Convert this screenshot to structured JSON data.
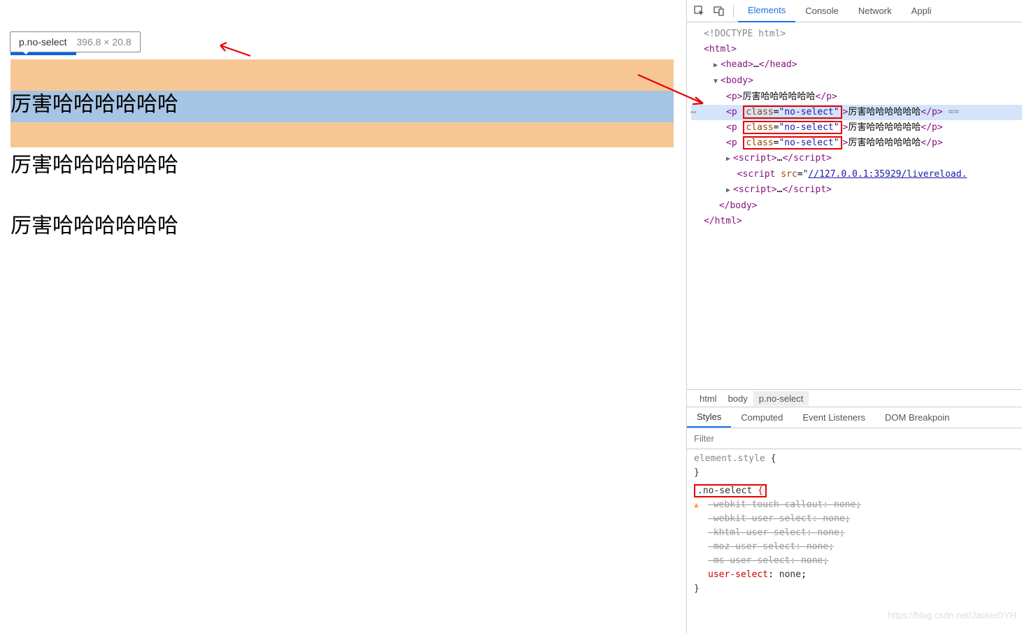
{
  "tooltip": {
    "selector": "p.no-select",
    "dims": "396.8 × 20.8"
  },
  "paragraphs": [
    "哈哈哈",
    "厉害哈哈哈哈哈哈",
    "厉害哈哈哈哈哈哈",
    "厉害哈哈哈哈哈哈"
  ],
  "devtools": {
    "tabs": [
      "Elements",
      "Console",
      "Network",
      "Appli"
    ],
    "active_tab": "Elements",
    "dom": {
      "doctype": "<!DOCTYPE html>",
      "html_open": "html",
      "head": {
        "open": "head",
        "close": "/head",
        "ellipsis": "…"
      },
      "body_open": "body",
      "p_lines": [
        {
          "text": "厉害哈哈哈哈哈哈",
          "has_class": false,
          "selected": false
        },
        {
          "text": "厉害哈哈哈哈哈哈",
          "has_class": true,
          "selected": true
        },
        {
          "text": "厉害哈哈哈哈哈哈",
          "has_class": true,
          "selected": false
        },
        {
          "text": "厉害哈哈哈哈哈哈",
          "has_class": true,
          "selected": false
        }
      ],
      "class_attr": "class",
      "class_val": "\"no-select\"",
      "script_ellipsis": "…",
      "script_src": "//127.0.0.1:35929/livereload.",
      "body_close": "/body",
      "html_close": "/html"
    },
    "breadcrumb": [
      "html",
      "body",
      "p.no-select"
    ],
    "styles_tabs": [
      "Styles",
      "Computed",
      "Event Listeners",
      "DOM Breakpoin"
    ],
    "styles_active": "Styles",
    "filter_placeholder": "Filter",
    "rules": {
      "elem_style": "element.style",
      "no_select": ".no-select",
      "props": [
        {
          "name": "-webkit-touch-callout",
          "value": "none",
          "striked": true,
          "warn": true
        },
        {
          "name": "-webkit-user-select",
          "value": "none",
          "striked": true,
          "warn": false
        },
        {
          "name": "-khtml-user-select",
          "value": "none",
          "striked": true,
          "warn": false
        },
        {
          "name": "-moz-user-select",
          "value": "none",
          "striked": true,
          "warn": false
        },
        {
          "name": "-ms-user-select",
          "value": "none",
          "striked": true,
          "warn": false
        },
        {
          "name": "user-select",
          "value": "none",
          "striked": false,
          "warn": false
        }
      ]
    }
  },
  "watermark": "https://blog.csdn.net/JackieDYH"
}
